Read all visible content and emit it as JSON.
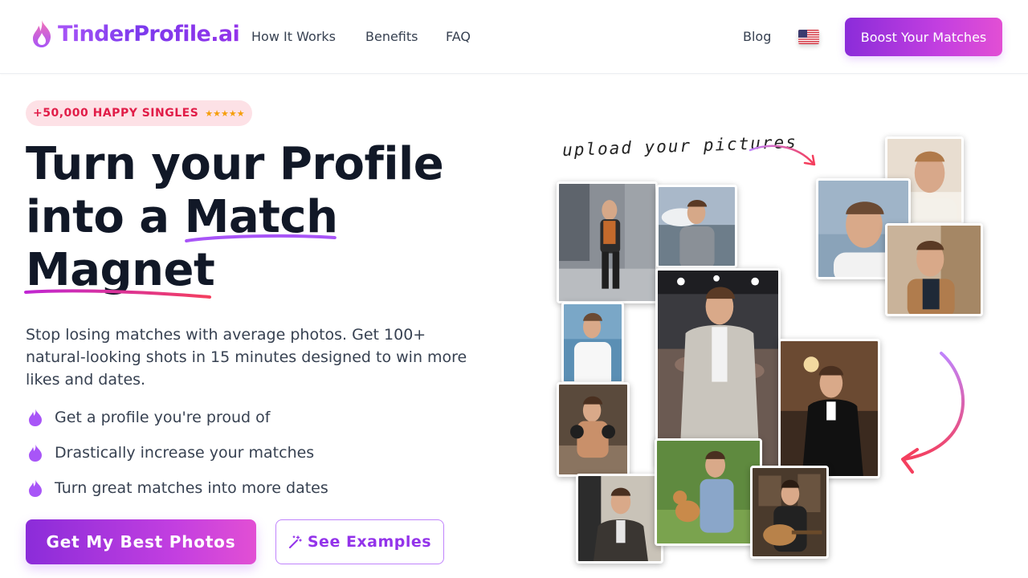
{
  "header": {
    "logo_text": "TinderProfile.ai",
    "nav": [
      {
        "label": "How It Works"
      },
      {
        "label": "Benefits"
      },
      {
        "label": "FAQ"
      }
    ],
    "blog_label": "Blog",
    "language_flag": "us-flag-icon",
    "cta_label": "Boost Your Matches"
  },
  "hero": {
    "badge_text": "+50,000 HAPPY SINGLES",
    "badge_stars": "★★★★★",
    "headline": {
      "line1": "Turn your Profile",
      "line2_prefix": "into a ",
      "line2_highlight": "Match",
      "line3": "Magnet"
    },
    "subheadline": "Stop losing matches with average photos. Get 100+ natural-looking shots in 15 minutes designed to win more likes and dates.",
    "benefits": [
      {
        "icon": "flame-icon",
        "text": "Get a profile you're proud of"
      },
      {
        "icon": "flame-icon",
        "text": "Drastically increase your matches"
      },
      {
        "icon": "flame-icon",
        "text": "Turn great matches into more dates"
      }
    ],
    "primary_cta": "Get My Best Photos",
    "secondary_cta": "See Examples",
    "secondary_icon": "magic-wand-icon"
  },
  "collage": {
    "caption": "upload your pictures"
  },
  "colors": {
    "brand_purple": "#9333ea",
    "brand_pink": "#e24fd4",
    "badge_bg": "#fde1e6",
    "badge_text": "#e11d48",
    "arrow_pink": "#f43f5e",
    "star_gold": "#f59e0b"
  }
}
